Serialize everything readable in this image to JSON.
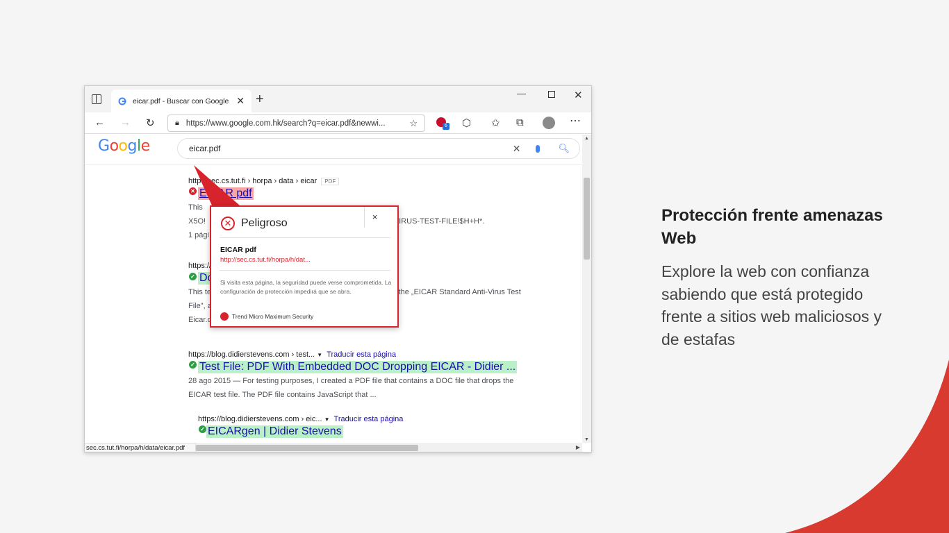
{
  "browser": {
    "tab_title": "eicar.pdf - Buscar con Google",
    "tab_close": "✕",
    "new_tab": "+",
    "url": "https://www.google.com.hk/search?q=eicar.pdf&newwi...",
    "extension_badge": "6",
    "status_url": "sec.cs.tut.fi/horpa/h/data/eicar.pdf"
  },
  "google": {
    "logo": [
      "G",
      "o",
      "o",
      "g",
      "l",
      "e"
    ],
    "query": "eicar.pdf"
  },
  "results": [
    {
      "cite": "http://sec.cs.tut.fi › horpa › data › eicar",
      "tag": "PDF",
      "title": "EICAR pdf",
      "snippet1": "This",
      "snippet2": "X5O!",
      "snippet2_tail": "NTIVIRUS-TEST-FILE!$H+H*.",
      "snippet3": "1 pági"
    },
    {
      "cite": "https://",
      "title": "Do",
      "snippet1": "This te",
      "snippet1_tail": "s the „EICAR Standard Anti-Virus Test",
      "snippet2": "File\", a",
      "snippet3": "Eicar.com, ..., de Bytes."
    },
    {
      "cite": "https://blog.didierstevens.com › test...",
      "translate": "Traducir esta página",
      "title": "Test File: PDF With Embedded DOC Dropping EICAR - Didier ...",
      "snippet1": "28 ago 2015 — For testing purposes, I created a PDF file that contains a DOC file that drops the",
      "snippet2": "EICAR test file. The PDF file contains JavaScript that ..."
    },
    {
      "cite": "https://blog.didierstevens.com › eic...",
      "translate": "Traducir esta página",
      "title": "EICARgen | Didier Stevens"
    }
  ],
  "popup": {
    "heading": "Peligroso",
    "close": "×",
    "name": "EICAR pdf",
    "url": "http://sec.cs.tut.fi/horpa/h/dat...",
    "message": "Si visita esta página, la seguridad puede verse comprometida. La configuración de protección impedirá que se abra.",
    "brand": "Trend Micro Maximum Security"
  },
  "side": {
    "title": "Protección frente amenazas Web",
    "description": "Explore la web con confianza sabiendo que está protegido frente a sitios web maliciosos y de estafas"
  },
  "colors": {
    "danger": "#d7242c",
    "safe_highlight": "#b9f0c8",
    "danger_highlight": "#f6a4a4",
    "link": "#1a0dab",
    "accent_swoosh": "#d83a2f"
  }
}
